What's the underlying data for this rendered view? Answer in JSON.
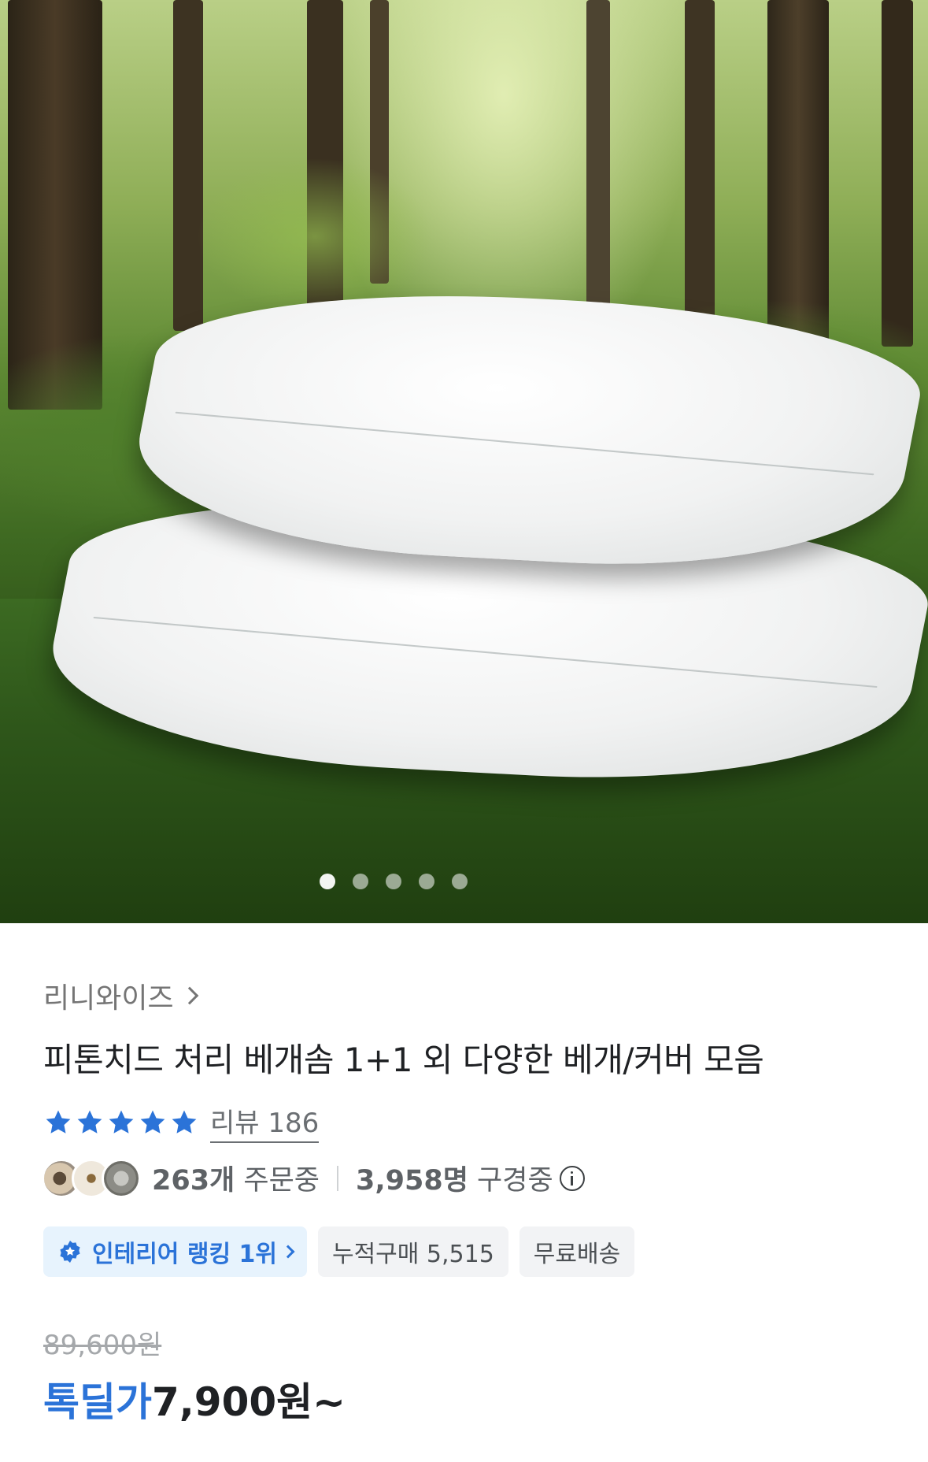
{
  "carousel": {
    "slides_total": 5,
    "active_index": 0,
    "image_description": "two-white-pillows-forest",
    "icons": [
      "carousel-dot"
    ]
  },
  "product": {
    "brand": "리니와이즈",
    "title": "피톤치드 처리 베개솜 1+1 외 다양한 베개/커버 모음",
    "rating_stars": 5,
    "review_label": "리뷰 186",
    "orders_count": "263개",
    "orders_label": " 주문중",
    "viewers_count": "3,958명",
    "viewers_label": " 구경중",
    "chips": {
      "ranking": "인테리어 랭킹 1위",
      "cumulative": "누적구매 5,515",
      "shipping": "무료배송"
    },
    "original_price": "89,600원",
    "sale_label": "톡딜가",
    "sale_price": "7,900원~"
  },
  "colors": {
    "accent_blue": "#2b73d8",
    "star_blue": "#2b73d8",
    "chip_bg": "#f2f3f5",
    "rank_chip_bg": "#e7f3fd"
  }
}
